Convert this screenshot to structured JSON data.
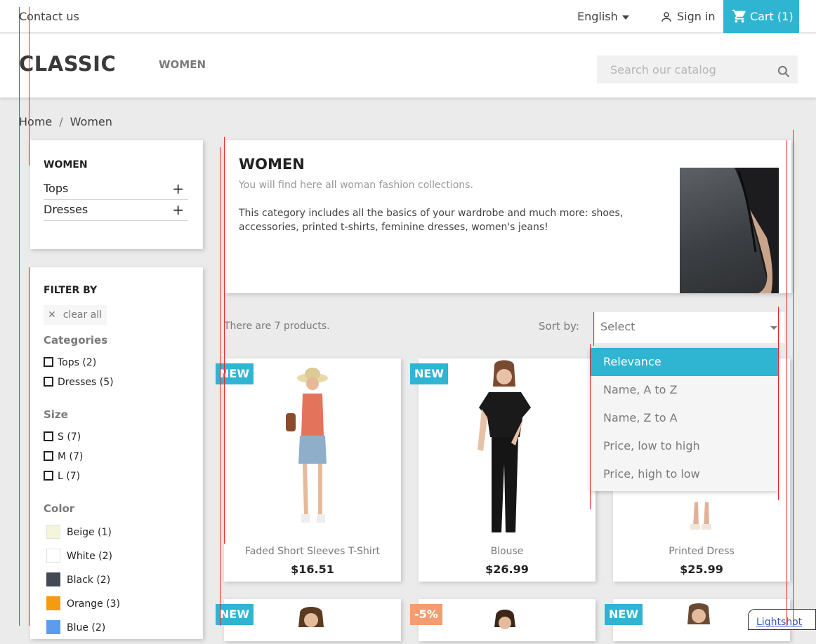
{
  "topbar": {
    "contact": "Contact us",
    "language": "English",
    "sign_in": "Sign in",
    "cart": "Cart (1)"
  },
  "header": {
    "logo": "CLASSIC",
    "nav": [
      "WOMEN"
    ],
    "search_placeholder": "Search our catalog"
  },
  "breadcrumb": [
    "Home",
    "/",
    "Women"
  ],
  "sidebar": {
    "category_title": "WOMEN",
    "categories": [
      {
        "label": "Tops"
      },
      {
        "label": "Dresses"
      }
    ],
    "filter": {
      "title": "FILTER BY",
      "clear_all": "clear all",
      "categories_label": "Categories",
      "categories": [
        "Tops (2)",
        "Dresses (5)"
      ],
      "size_label": "Size",
      "sizes": [
        "S (7)",
        "M (7)",
        "L (7)"
      ],
      "color_label": "Color",
      "colors": [
        {
          "label": "Beige (1)",
          "hex": "#f5f5dc"
        },
        {
          "label": "White (2)",
          "hex": "#ffffff"
        },
        {
          "label": "Black (2)",
          "hex": "#434a54"
        },
        {
          "label": "Orange (3)",
          "hex": "#f39c11"
        },
        {
          "label": "Blue (2)",
          "hex": "#5d9cec"
        }
      ]
    }
  },
  "category_header": {
    "title": "WOMEN",
    "subtitle": "You will find here all woman fashion collections.",
    "description": "This category includes all the basics of your wardrobe and much more: shoes, accessories, printed t-shirts, feminine dresses, women's jeans!"
  },
  "listing": {
    "count": "There are 7 products.",
    "sort_label": "Sort by:",
    "sort_select": "Select",
    "sort_options": [
      "Relevance",
      "Name, A to Z",
      "Name, Z to A",
      "Price, low to high",
      "Price, high to low"
    ]
  },
  "products": [
    {
      "badge": "NEW",
      "name": "Faded Short Sleeves T-Shirt",
      "price": "$16.51"
    },
    {
      "badge": "NEW",
      "name": "Blouse",
      "price": "$26.99"
    },
    {
      "badge": "",
      "name": "Printed Dress",
      "price": "$25.99"
    },
    {
      "badge": "NEW",
      "name": "",
      "price": ""
    },
    {
      "badge": "-5%",
      "name": "",
      "price": ""
    },
    {
      "badge": "NEW",
      "name": "",
      "price": ""
    }
  ],
  "lightshot": "Lightshot",
  "colors": {
    "accent": "#2fb5d2",
    "discount": "#f39d72"
  }
}
